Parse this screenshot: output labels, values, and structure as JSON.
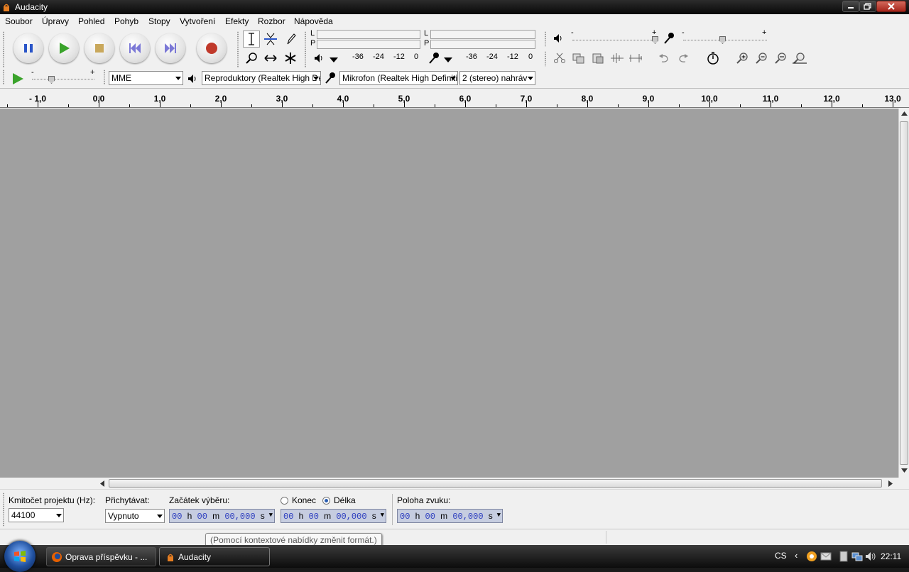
{
  "window": {
    "title": "Audacity"
  },
  "menu": [
    "Soubor",
    "Úpravy",
    "Pohled",
    "Pohyb",
    "Stopy",
    "Vytvoření",
    "Efekty",
    "Rozbor",
    "Nápověda"
  ],
  "meters": {
    "playback_channels": [
      "L",
      "P"
    ],
    "record_channels": [
      "L",
      "P"
    ],
    "scale": [
      "-36",
      "-24",
      "-12",
      "0"
    ]
  },
  "device": {
    "host": "MME",
    "output": "Reproduktory (Realtek High De",
    "input": "Mikrofon (Realtek High Definiti",
    "channels": "2 (stereo) nahráv"
  },
  "sliders": {
    "minus": "-",
    "plus": "+"
  },
  "ruler": [
    "- 1,0",
    "0,0",
    "1,0",
    "2,0",
    "3,0",
    "4,0",
    "5,0",
    "6,0",
    "7,0",
    "8,0",
    "9,0",
    "10,0",
    "11,0",
    "12,0",
    "13,0"
  ],
  "selection": {
    "rate_label": "Kmitočet projektu (Hz):",
    "rate_value": "44100",
    "snap_label": "Přichytávat:",
    "snap_value": "Vypnuto",
    "start_label": "Začátek výběru:",
    "end_label": "Konec",
    "length_label": "Délka",
    "position_label": "Poloha zvuku:",
    "time": {
      "hh": "00",
      "h": "h",
      "mm": "00",
      "m": "m",
      "ss": "00,000",
      "s": "s"
    }
  },
  "tooltip": "(Pomocí kontextové nabídky změnit formát.)",
  "taskbar": {
    "tasks": [
      "Oprava příspěvku - ...",
      "Audacity"
    ],
    "lang": "CS",
    "clock": "22:11"
  },
  "colors": {
    "track_bg": "#a0a0a0",
    "time_digits": "#2c3dbf",
    "record": "#c0392b",
    "play": "#3aa32b"
  }
}
